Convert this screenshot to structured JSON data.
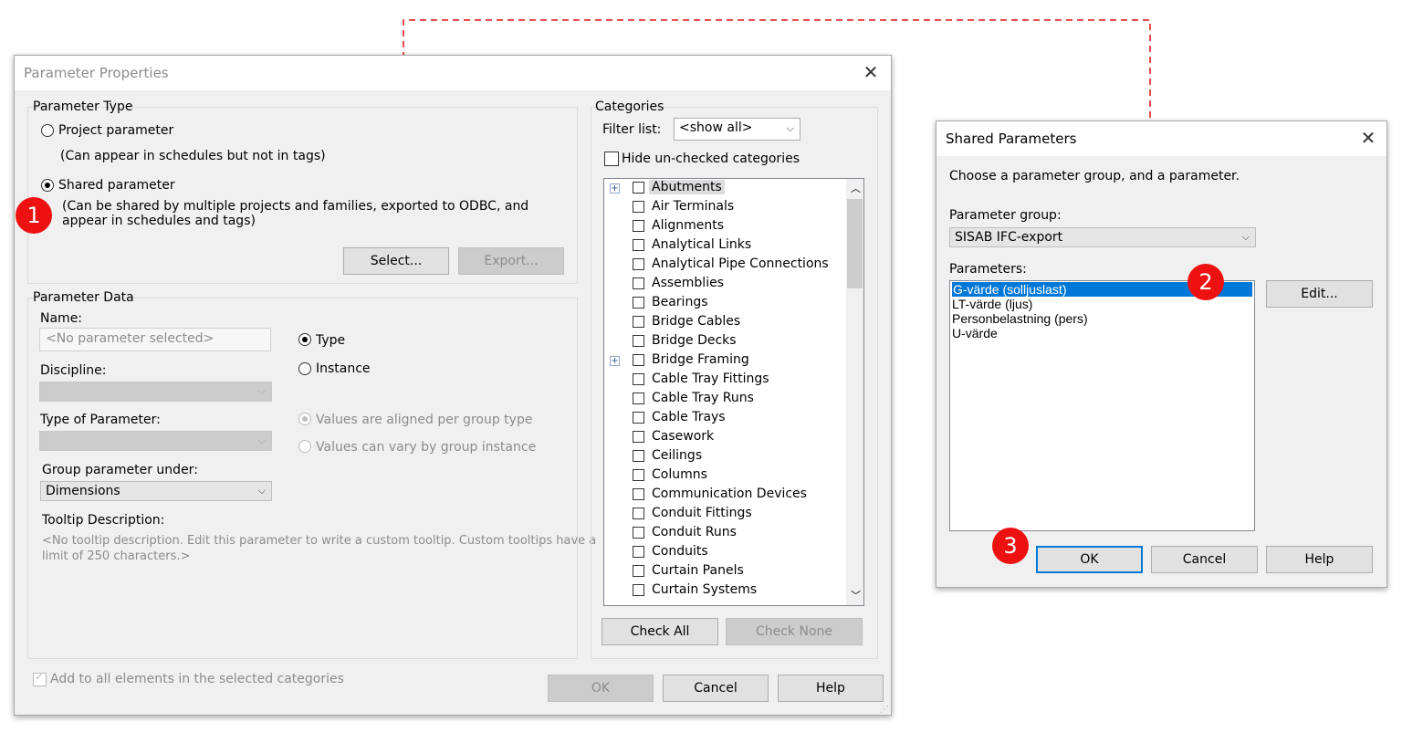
{
  "parameter_properties": {
    "title": "Parameter Properties",
    "parameter_type": {
      "group_label": "Parameter Type",
      "project_parameter_label": "Project parameter",
      "project_parameter_desc": "(Can appear in schedules but not in tags)",
      "shared_parameter_label": "Shared parameter",
      "shared_parameter_desc_1": "(Can be shared by multiple projects and families, exported to ODBC, and",
      "shared_parameter_desc_2": "appear in schedules and tags)",
      "selected": "shared",
      "select_button": "Select...",
      "export_button": "Export..."
    },
    "parameter_data": {
      "group_label": "Parameter Data",
      "name_label": "Name:",
      "name_placeholder": "<No parameter selected>",
      "type_radio": "Type",
      "instance_radio": "Instance",
      "discipline_label": "Discipline:",
      "type_of_parameter_label": "Type of Parameter:",
      "values_aligned": "Values are aligned per group type",
      "values_vary": "Values can vary by group instance",
      "group_under_label": "Group parameter under:",
      "group_under_value": "Dimensions",
      "tooltip_label": "Tooltip Description:",
      "tooltip_text_1": "<No tooltip description. Edit this parameter to write a custom tooltip. Custom tooltips have a",
      "tooltip_text_2": "limit of 250 characters.>"
    },
    "categories": {
      "group_label": "Categories",
      "filter_label": "Filter list:",
      "filter_value": "<show all>",
      "hide_unchecked_label": "Hide un-checked categories",
      "items": [
        "Abutments",
        "Air Terminals",
        "Alignments",
        "Analytical Links",
        "Analytical Pipe Connections",
        "Assemblies",
        "Bearings",
        "Bridge Cables",
        "Bridge Decks",
        "Bridge Framing",
        "Cable Tray Fittings",
        "Cable Tray Runs",
        "Cable Trays",
        "Casework",
        "Ceilings",
        "Columns",
        "Communication Devices",
        "Conduit Fittings",
        "Conduit Runs",
        "Conduits",
        "Curtain Panels",
        "Curtain Systems"
      ],
      "check_all": "Check All",
      "check_none": "Check None"
    },
    "add_to_all_label": "Add to all elements in the selected categories",
    "ok_button": "OK",
    "cancel_button": "Cancel",
    "help_button": "Help"
  },
  "shared_parameters": {
    "title": "Shared Parameters",
    "instruction": "Choose a parameter group, and a parameter.",
    "group_label": "Parameter group:",
    "group_value": "SISAB IFC-export",
    "parameters_label": "Parameters:",
    "parameters": [
      "G-värde (solljuslast)",
      "LT-värde (ljus)",
      "Personbelastning (pers)",
      "U-värde"
    ],
    "edit_button": "Edit...",
    "ok_button": "OK",
    "cancel_button": "Cancel",
    "help_button": "Help"
  },
  "markers": [
    "1",
    "2",
    "3"
  ],
  "colors": {
    "marker": "#ee1111",
    "arrow": "#dd1111",
    "selection": "#0078d7"
  }
}
